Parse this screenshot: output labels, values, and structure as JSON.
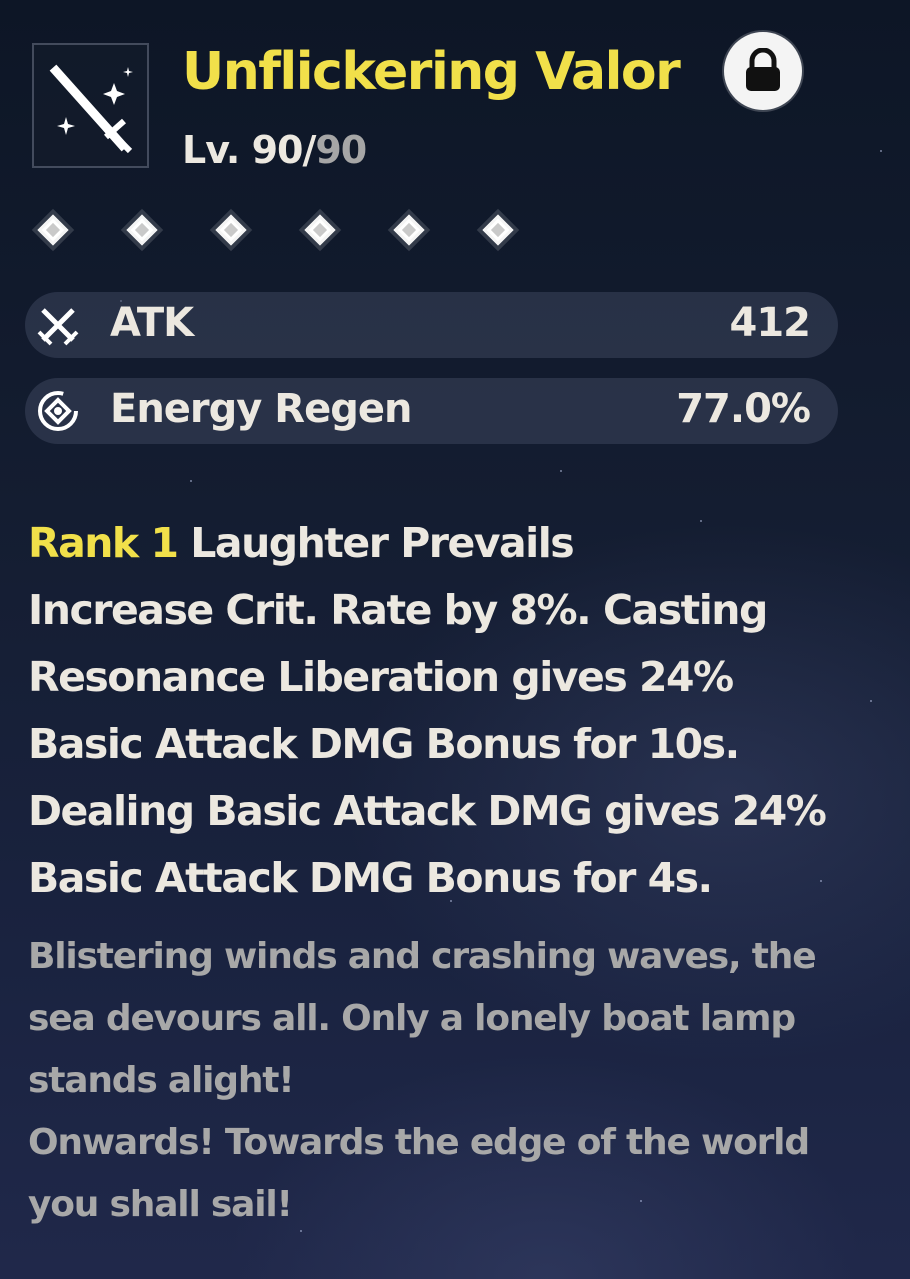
{
  "weapon": {
    "icon": "sword-icon",
    "name": "Unflickering Valor",
    "level_prefix": "Lv. ",
    "level_current": "90",
    "level_sep": "/",
    "level_max": "90",
    "locked": true,
    "rank_stars": 6
  },
  "stats": [
    {
      "icon": "atk-swords-icon",
      "label": "ATK",
      "value": "412"
    },
    {
      "icon": "energy-regen-icon",
      "label": "Energy Regen",
      "value": "77.0%"
    }
  ],
  "passive": {
    "rank_label": "Rank 1",
    "name": " Laughter Prevails",
    "lines": [
      "Increase Crit. Rate by 8%. Casting",
      "Resonance Liberation gives 24%",
      "Basic Attack DMG Bonus for 10s.",
      "Dealing Basic Attack DMG gives 24%",
      "Basic Attack DMG Bonus for 4s."
    ]
  },
  "lore": {
    "lines": [
      "Blistering winds and crashing waves, the",
      "sea devours all. Only a lonely boat lamp",
      "stands alight!",
      "Onwards! Towards the edge of the world",
      "you shall sail!"
    ]
  },
  "colors": {
    "title": "#f1e04a",
    "text": "#ece8e0",
    "lore": "#a8a8a8"
  }
}
